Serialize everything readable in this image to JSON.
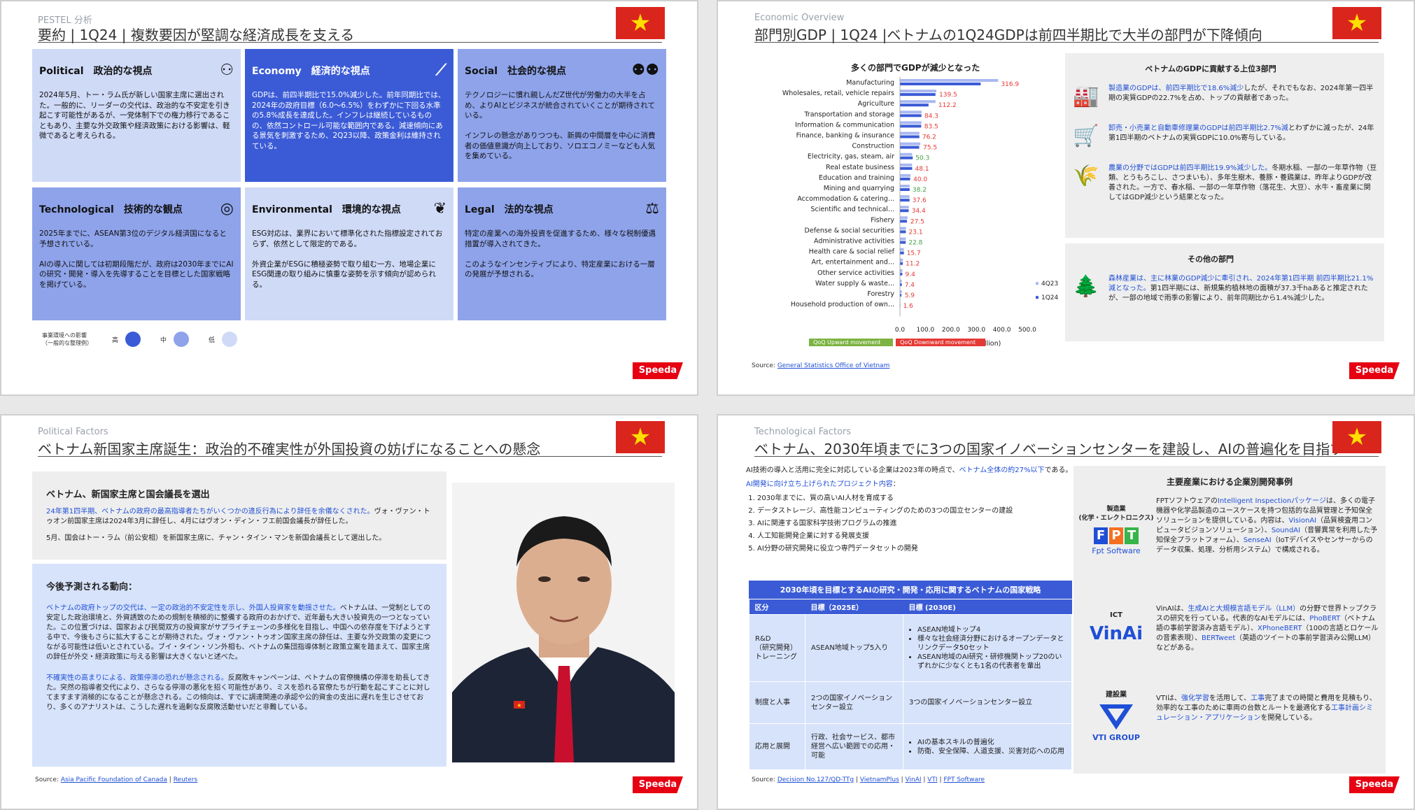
{
  "slide1": {
    "eyebrow": "PESTEL 分析",
    "title": "要約 | 1Q24 | 複数要因が堅調な経済成長を支える",
    "cards": [
      {
        "head": "Political　政治的な視点",
        "level": "low",
        "icon": "people-icon",
        "text": "2024年5月、トー・ラム氏が新しい国家主席に選出された。一般的に、リーダーの交代は、政治的な不安定を引き起こす可能性があるが、一党体制下での権力移行であることもあり、主要な外交政策や経済政策における影響は、軽微であると考えられる。"
      },
      {
        "head": "Economy　経済的な視点",
        "level": "high",
        "icon": "chart-icon",
        "text": "GDPは、前四半期比で15.0%減少した。前年同期比では、2024年の政府目標（6.0～6.5%）をわずかに下回る水準の5.8%成長を達成した。インフレは継続しているものの、依然コントロール可能な範囲内である。減速傾向にある景気を刺激するため、2Q23以降、政策金利は維持されている。"
      },
      {
        "head": "Social　社会的な視点",
        "level": "mid",
        "icon": "persons-icon",
        "text": "テクノロジーに慣れ親しんだZ世代が労働力の大半を占め、よりAIとビジネスが統合されていくことが期待されている。\n\nインフレの懸念がありつつも、新興の中間層を中心に消費者の価値意識が向上しており、ソロエコノミーなども人気を集めている。"
      },
      {
        "head": "Technological　技術的な観点",
        "level": "mid",
        "icon": "wireless-icon",
        "text": "2025年までに、ASEAN第3位のデジタル経済国になると予想されている。\n\nAIの導入に関しては初期段階だが、政府は2030年までにAIの研究・開発・導入を先導することを目標とした国家戦略を掲げている。"
      },
      {
        "head": "Environmental　環境的な視点",
        "level": "low",
        "icon": "leaf-hand-icon",
        "text": "ESG対応は、業界において標準化された指標設定されておらず、依然として限定的である。\n\n外資企業がESGに積極姿勢で取り組む一方、地場企業にESG関連の取り組みに慎重な姿勢を示す傾向が認められる。"
      },
      {
        "head": "Legal　法的な視点",
        "level": "mid",
        "icon": "scales-icon",
        "text": "特定の産業への海外投資を促進するため、様々な税制優遇措置が導入されてきた。\n\nこのようなインセンティブにより、特定産業における一層の発展が予想される。"
      }
    ],
    "legend_label": "事業環境への影響\n（一般的な整理例）",
    "legend_high": "高",
    "legend_mid": "中",
    "legend_low": "低",
    "logo": "Speeda"
  },
  "slide2": {
    "eyebrow": "Economic Overview",
    "title": "部門別GDP | 1Q24 |ベトナムの1Q24GDPは前四半期比で大半の部門が下降傾向",
    "chart_title": "多くの部門でGDPが減少となった",
    "legend_upward": "QoQ Upward movement",
    "legend_downward": "QoQ Downward movement",
    "source_label": "Source:",
    "source_link": "General Statistics Office of Vietnam",
    "panel1_title": "ベトナムのGDPに貢献する上位3部門",
    "panel1_items": [
      {
        "icon": "factory-icon",
        "highlight": "製造業のGDPは、前四半期比で18.6%減少",
        "rest": "したが、それでもなお、2024年第一四半期の実質GDPの22.7%を占め、トップの貢献者であった。"
      },
      {
        "icon": "cart-icon",
        "highlight": "卸売・小売業と自動車修理業のGDPは前四半期比2.7%減",
        "rest": "とわずかに減ったが、24年第1四半期のベトナムの実質GDPに10.0%寄与している。"
      },
      {
        "icon": "wheat-icon",
        "highlight": "農業の分野ではGDPは前四半期比19.9%減少した。",
        "rest": "冬期水稲、一部の一年草作物（豆類、とうもろこし、さつまいも）、多年生樹木、養豚・養鶏業は、昨年よりGDPが改善された。一方で、春水稲、一部の一年草作物（落花生、大豆）、水牛・畜産業に関してはGDP減少という結果となった。"
      }
    ],
    "panel2_title": "その他の部門",
    "panel2_item": {
      "icon": "tree-icon",
      "highlight": "森林産業は、主に林業のGDP減少に牽引され、2024年第1四半期 前四半期比21.1%減となった。",
      "rest": "第1四半期には、新規集約植林地の面積が37.3千haあると推定されたが、一部の地域で雨季の影響により、前年同期比から1.4%減少した。"
    }
  },
  "chart_data": {
    "type": "bar",
    "orientation": "horizontal",
    "title": "多くの部門でGDPが減少となった",
    "xlabel": "Real GDP (VND billion)",
    "ylabel": "",
    "xlim": [
      0,
      500
    ],
    "xticks": [
      "0.0",
      "100.0",
      "200.0",
      "300.0",
      "400.0",
      "500.0"
    ],
    "categories": [
      "Manufacturing",
      "Wholesales, retail, vehicle repairs",
      "Agriculture",
      "Transportation and storage",
      "Information & communication",
      "Finance, banking & insurance",
      "Construction",
      "Electricity, gas, steam, air",
      "Real estate business",
      "Education and training",
      "Mining and quarrying",
      "Accommodation & catering...",
      "Scientific and technical...",
      "Fishery",
      "Defense & social securities",
      "Administrative activities",
      "Health care & social relief",
      "Art, entertainment and...",
      "Other service activities",
      "Water supply & waste...",
      "Forestry",
      "Household production of own..."
    ],
    "series": [
      {
        "name": "4Q23",
        "color": "#a9b8f0",
        "values": [
          385.7,
          143.0,
          139.9,
          85.0,
          84.5,
          76.5,
          80.0,
          47.9,
          47.5,
          41.5,
          38.0,
          37.7,
          35.0,
          30.0,
          23.5,
          23.0,
          15.6,
          11.5,
          9.6,
          7.2,
          7.5,
          1.6
        ]
      },
      {
        "name": "1Q24",
        "color": "#3b5bd6",
        "values": [
          316.9,
          139.5,
          112.2,
          84.3,
          83.5,
          76.2,
          75.5,
          50.3,
          48.1,
          40.0,
          38.2,
          37.6,
          34.4,
          27.5,
          23.1,
          22.8,
          15.7,
          11.2,
          9.4,
          7.4,
          5.9,
          1.6
        ]
      }
    ],
    "label_colors": [
      "#e53935",
      "#e53935",
      "#e53935",
      "#e53935",
      "#e53935",
      "#e53935",
      "#e53935",
      "#43a047",
      "#e53935",
      "#e53935",
      "#43a047",
      "#e53935",
      "#e53935",
      "#e53935",
      "#e53935",
      "#43a047",
      "#e53935",
      "#e53935",
      "#e53935",
      "#e53935",
      "#e53935",
      "#e53935"
    ],
    "data_labels": [
      "316.9",
      "139.5",
      "112.2",
      "84.3",
      "83.5",
      "76.2",
      "75.5",
      "50.3",
      "48.1",
      "40.0",
      "38.2",
      "37.6",
      "34.4",
      "27.5",
      "23.1",
      "22.8",
      "15.7",
      "11.2",
      "9.4",
      "7.4",
      "5.9",
      "1.6"
    ],
    "legend_position": "right"
  },
  "slide3": {
    "eyebrow": "Political Factors",
    "title": "ベトナム新国家主席誕生：政治的不確実性が外国投資の妨げになることへの懸念",
    "box1_title": "ベトナム、新国家主席と国会議長を選出",
    "box1_p1_hl": "24年第1四半期、ベトナムの政府の最高指導者たちがいくつかの違反行為により辞任を余儀なくされた。",
    "box1_p1_rest": "ヴォ・ヴァン・トゥオン前国家主席は2024年3月に辞任し、4月にはヴオン・ディン・フエ前国会議長が辞任した。",
    "box1_p2": "5月、国会はトー・ラム（前公安相）を新国家主席に、チャン・タイン・マンを新国会議長として選出した。",
    "box2_title": "今後予測される動向：",
    "box2_p1_hl": "ベトナムの政府トップの交代は、一定の政治的不安定性を示し、外国人投資家を動揺させた。",
    "box2_p1_rest": "ベトナムは、一党制としての安定した政治環境と、外資誘致のための規制を積極的に整備する政府のおかげで、近年最も大きい投資先の一つとなっていた。この位置づけは、国家および民間双方の投資家がサプライチェーンの多様化を目指し、中国への依存度を下げようとする中で、今後もさらに拡大することが期待された。ヴォ・ヴァン・トゥオン国家主席の辞任は、主要な外交政策の変更につながる可能性は低いとされている。ブイ・タイン・ソン外相も、ベトナムの集団指導体制と政策立案を踏まえて、国家主席の辞任が外交・経済政策に与える影響は大きくないと述べた。",
    "box2_p2_hl": "不確実性の高まりによる、政策停滞の恐れが懸念される。",
    "box2_p2_rest": "反腐敗キャンペーンは、ベトナムの官僚機構の停滞を助長してきた。突然の指導者交代により、さらなる停滞の悪化を招く可能性があり、ミスを恐れる官僚たちが行動を起こすことに対してますます消極的になることが懸念される。この傾向は、すでに調達関連の承認や公的資金の支出に遅れを生じさせており、多くのアナリストは、こうした遅れを過剰な反腐敗活動せいだと非難している。",
    "source_label": "Source:",
    "source_link1": "Asia Pacific Foundation of Canada",
    "source_link2": "Reuters"
  },
  "slide4": {
    "eyebrow": "Technological Factors",
    "title": "ベトナム、2030年頃までに3つの国家イノベーションセンターを建設し、AIの普遍化を目指す",
    "intro_start": "AI技術の導入と活用に完全に対応している企業は2023年の時点で、",
    "intro_hl": "ベトナム全体の約27%以下",
    "intro_end": "である。",
    "projects_title": "AI開発に向け立ち上げられたプロジェクト内容",
    "projects_colon": "：",
    "projects": [
      "2030年までに、質の高いAI人材を育成する",
      "データストレージ、高性能コンピューティングのための3つの国立センターの建設",
      "AIに関連する国家科学技術プログラムの推進",
      "人工知能開発企業に対する発展支援",
      "AI分野の研究開発に役立つ専門データセットの開発"
    ],
    "table_caption": "2030年頃を目標とするAIの研究・開発・応用に関するベトナムの国家戦略",
    "table_headers": [
      "区分",
      "目標（2025E）",
      "目標 (2030E)"
    ],
    "table_rows": [
      {
        "c0": "R&D\n（研究開発）\nトレーニング",
        "c1": "ASEAN地域トップ5入り",
        "c2": [
          "ASEAN地域トップ4",
          "様々な社会経済分野におけるオープンデータとリンクデータ50セット",
          "ASEAN地域のAI研究・研修機関トップ20のいずれかに少なくとも1名の代表者を輩出"
        ]
      },
      {
        "c0": "制度と人事",
        "c1": "2つの国家イノベーションセンター設立",
        "c2": [
          "3つの国家イノベーションセンター設立"
        ]
      },
      {
        "c0": "応用と展開",
        "c1": "行政、社会サービス、都市経営へ広い範囲での応用・可能",
        "c2": [
          "AIの基本スキルの普遍化",
          "防衛、安全保障、人道支援、災害対応への応用"
        ]
      }
    ],
    "right_title": "主要産業における企業別開発事例",
    "industries": [
      {
        "name": "製造業\n(化学・エレクトロニクス)",
        "logo": "FPT",
        "logo_sub": "Fpt Software",
        "text_a": "FPTソフトウェアの",
        "hl_a": "Intelligent Inspectionパッケージ",
        "text_b": "は、多くの電子機器や化学品製造のユースケースを持つ包括的な品質管理と予知保全ソリューションを提供している。内容は、",
        "hl_b": "VisionAI",
        "text_c": "（品質検査用コンピュータビジョンソリューション）、",
        "hl_c": "SoundAI",
        "text_d": "（音響異常を利用した予知保全プラットフォーム）、",
        "hl_d": "SenseAI",
        "text_e": "（IoTデバイスやセンサーからのデータ収集、処理、分析用システム）で構成される。"
      },
      {
        "name": "ICT",
        "logo": "VinAi",
        "text_a": "VinAIは、",
        "hl_a": "生成AIと大規模言語モデル（LLM）",
        "text_b": "の分野で世界トップクラスの研究を行っている。代表的なAIモデルには、",
        "hl_b": "PhoBERT",
        "text_c": "（ベトナム語の事前学習済み言語モデル）、",
        "hl_c": "XPhoneBERT",
        "text_d": "（100の言語とロケールの音素表現）、",
        "hl_d": "BERTweet",
        "text_e": "（英語のツイートの事前学習済み公開LLM）などがある。"
      },
      {
        "name": "建設業",
        "logo": "VTI GROUP",
        "text_a": "VTIは、",
        "hl_a": "強化学習",
        "text_b": "を活用して、",
        "hl_b": "工事",
        "text_c": "完了までの時間と費用を見積もり、効率的な工事のために車両の台数とルートを最適化する",
        "hl_c": "工事計画シミュレーション・アプリケーション",
        "text_d": "を開発している。",
        "hl_d": "",
        "text_e": ""
      }
    ],
    "source_label": "Source:",
    "sources": [
      "Decision No.127/QD-TTg",
      "VietnamPlus",
      "VinAI",
      "VTI",
      "FPT Software"
    ]
  }
}
